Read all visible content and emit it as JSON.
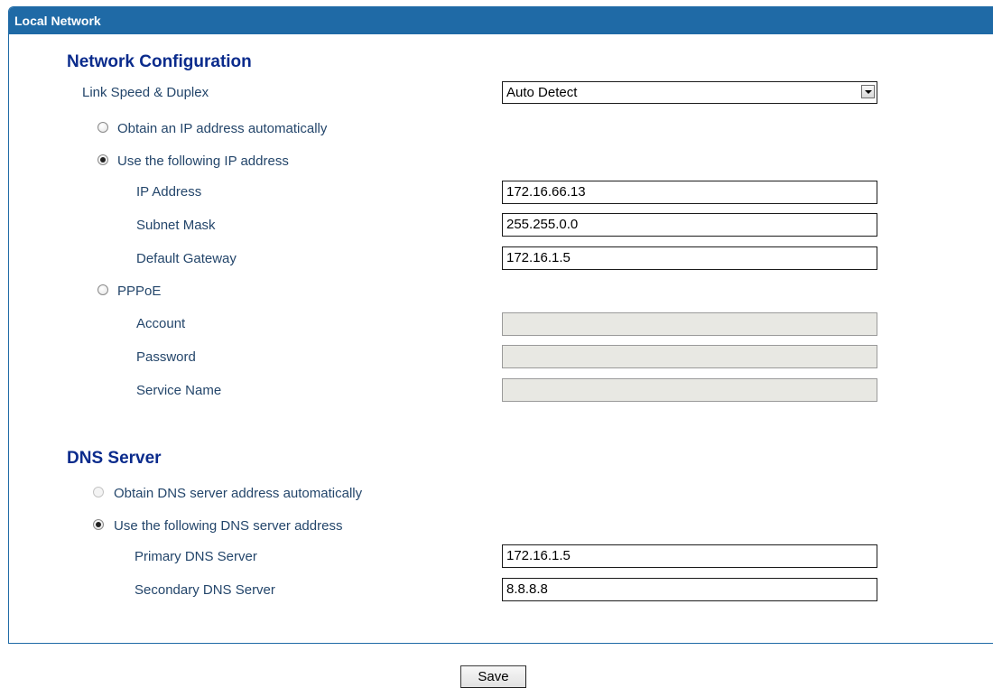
{
  "panel": {
    "title": "Local Network"
  },
  "network": {
    "title": "Network Configuration",
    "link_speed": {
      "label": "Link Speed & Duplex",
      "value": "Auto Detect"
    },
    "auto_ip_label": "Obtain an IP address automatically",
    "static_ip_label": "Use the following IP address",
    "ip_address": {
      "label": "IP Address",
      "value": "172.16.66.13"
    },
    "subnet_mask": {
      "label": "Subnet Mask",
      "value": "255.255.0.0"
    },
    "default_gateway": {
      "label": "Default Gateway",
      "value": "172.16.1.5"
    },
    "pppoe_label": "PPPoE",
    "account": {
      "label": "Account",
      "value": ""
    },
    "password": {
      "label": "Password",
      "value": ""
    },
    "service_name": {
      "label": "Service Name",
      "value": ""
    },
    "selected_mode": "static"
  },
  "dns": {
    "title": "DNS Server",
    "auto_label": "Obtain DNS server address automatically",
    "manual_label": "Use the following DNS server address",
    "primary": {
      "label": "Primary DNS Server",
      "value": "172.16.1.5"
    },
    "secondary": {
      "label": "Secondary DNS Server",
      "value": "8.8.8.8"
    },
    "selected_mode": "manual"
  },
  "actions": {
    "save_label": "Save"
  },
  "colors": {
    "header_bg": "#1f6aa6",
    "section_title": "#0a2b8c",
    "label_text": "#24466b"
  }
}
